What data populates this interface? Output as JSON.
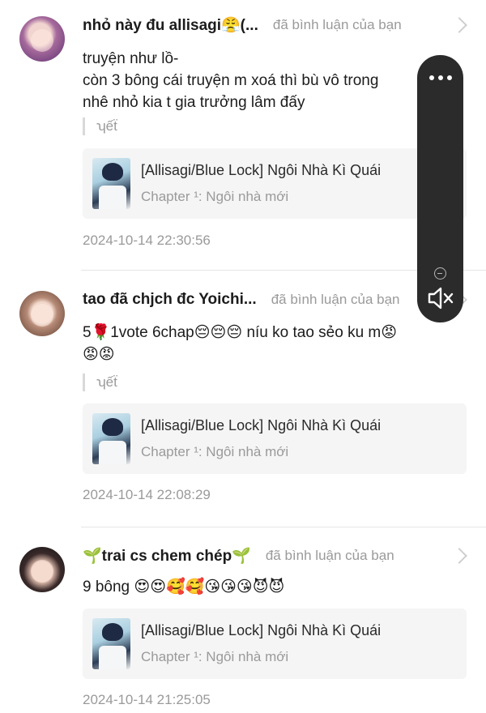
{
  "comments": [
    {
      "username": "nhỏ này đu allisagi😤(...",
      "action": "đã bình luận của bạn",
      "lines": [
        "truyện như lồ-",
        "còn 3 bông cái truyện m xoá thì bù vô trong",
        "nhê nhỏ kia t gia trưởng lâm đấy"
      ],
      "quote": "ʮếẗ",
      "card_title": "[Allisagi/Blue Lock] Ngôi Nhà Kì Quái",
      "card_sub": "Chapter ¹: Ngôi nhà mới",
      "timestamp": "2024-10-14 22:30:56"
    },
    {
      "username": "tao đã chjch đc Yoichi...",
      "action": "đã bình luận của bạn",
      "lines": [
        "5🌹1vote  6chap😔😔😔 níu ko tao sẻo ku m😡",
        "😡😡"
      ],
      "quote": "ʮếẗ",
      "card_title": "[Allisagi/Blue Lock] Ngôi Nhà Kì Quái",
      "card_sub": "Chapter ¹: Ngôi nhà mới",
      "timestamp": "2024-10-14 22:08:29"
    },
    {
      "username": "🌱trai cs chem chép🌱",
      "action": "đã bình luận của bạn",
      "lines": [
        "9 bông 😍😍🥰🥰😘😘😘😈😈"
      ],
      "card_title": "[Allisagi/Blue Lock] Ngôi Nhà Kì Quái",
      "card_sub": "Chapter ¹: Ngôi nhà mới",
      "timestamp": "2024-10-14 21:25:05"
    }
  ],
  "icons": {
    "more": "more-dots-icon",
    "minimize": "minimize-icon",
    "mute": "speaker-muted-icon",
    "chevron": "chevron-right-icon"
  },
  "colors": {
    "muted_text": "#9a9a9a",
    "card_bg": "#f5f5f5",
    "capsule_bg": "#2b2b2b"
  }
}
